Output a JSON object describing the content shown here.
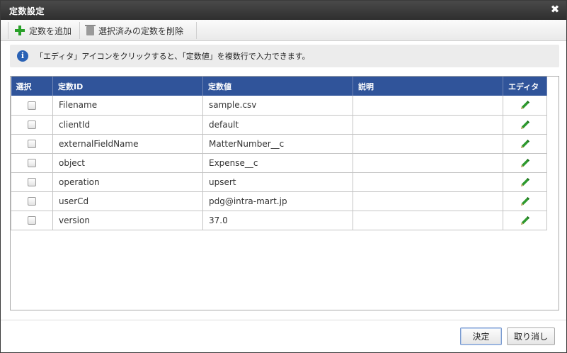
{
  "window": {
    "title": "定数設定",
    "close_symbol": "✖"
  },
  "toolbar": {
    "add_label": "定数を追加",
    "delete_label": "選択済みの定数を削除"
  },
  "info": {
    "icon_glyph": "i",
    "message": "「エディタ」アイコンをクリックすると、「定数値」を複数行で入力できます。"
  },
  "table": {
    "columns": [
      "選択",
      "定数ID",
      "定数値",
      "説明",
      "エディタ"
    ],
    "rows": [
      {
        "id": "Filename",
        "value": "sample.csv",
        "description": ""
      },
      {
        "id": "clientId",
        "value": "default",
        "description": ""
      },
      {
        "id": "externalFieldName",
        "value": "MatterNumber__c",
        "description": ""
      },
      {
        "id": "object",
        "value": "Expense__c",
        "description": ""
      },
      {
        "id": "operation",
        "value": "upsert",
        "description": ""
      },
      {
        "id": "userCd",
        "value": "pdg@intra-mart.jp",
        "description": ""
      },
      {
        "id": "version",
        "value": "37.0",
        "description": ""
      }
    ]
  },
  "footer": {
    "ok_label": "決定",
    "cancel_label": "取り消し"
  },
  "colors": {
    "header_bg": "#30549a",
    "title_bg": "#3a3a3a",
    "edit_icon": "#2e9a2e",
    "add_icon": "#2aa02a",
    "info_icon": "#2a62b5"
  }
}
